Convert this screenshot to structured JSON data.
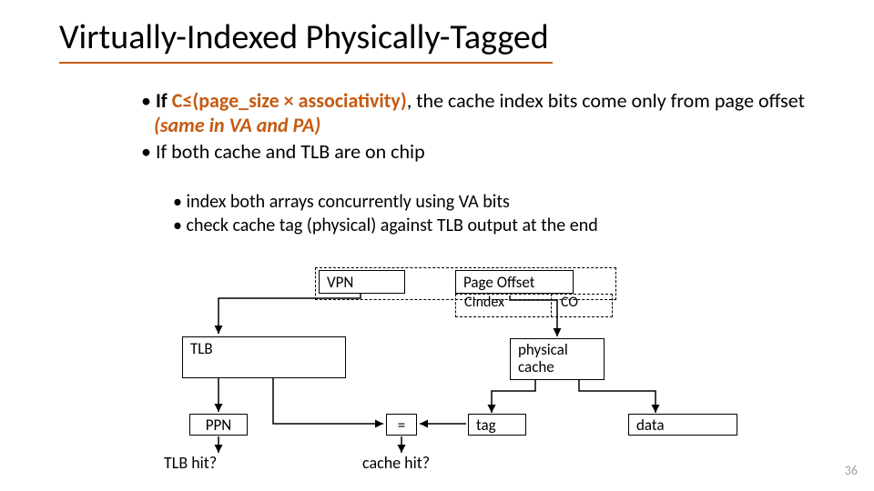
{
  "title": "Virtually-Indexed Physically-Tagged",
  "bullets": {
    "l1": {
      "b1a": "If ",
      "b1b": "C≤(page_size × associativity)",
      "b1c": ", the cache index bits come only from page offset ",
      "b1d": "(same in VA and PA)",
      "b2": "If both cache and TLB are on chip"
    },
    "l2": {
      "b1": "index both arrays concurrently using VA bits",
      "b2": "check cache tag (physical) against TLB output at the end"
    }
  },
  "diagram": {
    "vpn": "VPN",
    "page_offset": "Page Offset",
    "cindex": "CIndex",
    "co": "CO",
    "tlb": "TLB",
    "cache": "physical\ncache",
    "ppn": "PPN",
    "eq": "=",
    "tag": "tag",
    "data": "data",
    "tlb_hit": "TLB hit?",
    "cache_hit": "cache hit?"
  },
  "page_number": "36"
}
